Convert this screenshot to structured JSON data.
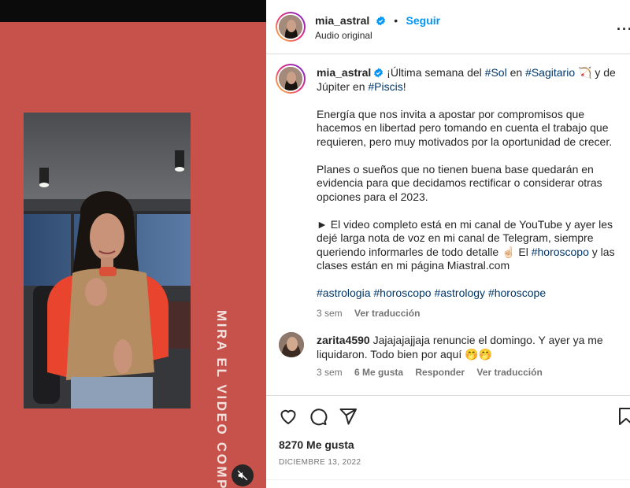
{
  "header": {
    "username": "mia_astral",
    "follow_label": "Seguir",
    "audio_label": "Audio original",
    "more_label": "···"
  },
  "caption": {
    "username": "mia_astral",
    "line1_a": "¡Última semana del ",
    "tag_sol": "#Sol",
    "line1_b": " en ",
    "tag_sagitario": "#Sagitario",
    "emoji_arrow": "🏹",
    "line1_c": " y de Júpiter en ",
    "tag_piscis": "#Piscis",
    "line1_d": "!",
    "para2": "Energía que nos invita a apostar por compromisos que hacemos en libertad pero tomando en cuenta el trabajo que requieren, pero muy motivados por la oportunidad de crecer.",
    "para3": "Planes o sueños que no tienen buena base quedarán en evidencia para que decidamos rectificar o considerar otras opciones para el 2023.",
    "para4_a": "► El video completo está en mi canal de YouTube y ayer les dejé larga nota de voz en mi canal de Telegram, siempre queriendo informarles de todo detalle ",
    "emoji_hand": "☝🏻",
    "para4_b": " El ",
    "tag_horoscopo_inline": "#horoscopo",
    "para4_c": " y las clases están en mi página Miastral.com",
    "hashtags": [
      "#astrologia",
      "#horoscopo",
      "#astrology",
      "#horoscope"
    ],
    "time": "3 sem",
    "translate_label": "Ver traducción"
  },
  "comment": {
    "username": "zarita4590",
    "text": "Jajajajajjaja renuncie el domingo. Y ayer ya me liquidaron. Todo bien por aquí 🤭🤭",
    "time": "3 sem",
    "likes": "6 Me gusta",
    "reply_label": "Responder",
    "translate_label": "Ver traducción"
  },
  "actions": {
    "likes": "8270 Me gusta",
    "date": "DICIEMBRE 13, 2022"
  },
  "media": {
    "vertical_caption": "MIRA EL VIDEO COMP",
    "background_color": "#c6524b"
  },
  "colors": {
    "link_blue": "#0095f6",
    "hashtag": "#00376b",
    "muted": "#737373"
  },
  "icons": [
    "verified-badge-icon",
    "heart-icon",
    "comment-icon",
    "share-icon",
    "bookmark-icon",
    "mute-icon",
    "more-options-icon"
  ]
}
